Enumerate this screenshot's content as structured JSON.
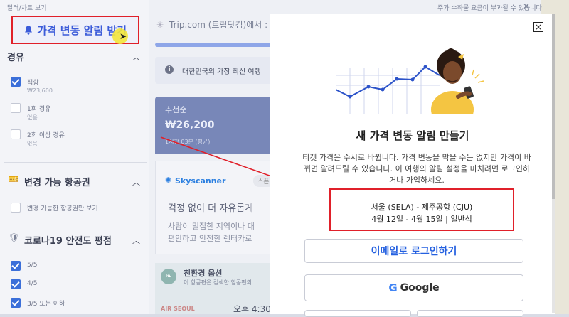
{
  "top": {
    "left_link": "달러/차트 보기",
    "right_text": "주가 수하물 요금이 부과될 수 있습니다",
    "close": "✕"
  },
  "sidebar": {
    "alert_button": "가격 변동 알림 받기",
    "sections": {
      "stops": {
        "title": "경유",
        "items": [
          {
            "label": "직항",
            "sub": "₩23,600",
            "checked": true
          },
          {
            "label": "1회 경유",
            "sub": "없음",
            "checked": false
          },
          {
            "label": "2회 이상 경유",
            "sub": "없음",
            "checked": false
          }
        ]
      },
      "airports": {
        "title": "변경 가능 항공권",
        "items": [
          {
            "label": "변경 가능한 항공권만 보기",
            "checked": false
          }
        ]
      },
      "covid": {
        "title": "코로나19 안전도 평점",
        "items": [
          {
            "label": "5/5",
            "checked": true
          },
          {
            "label": "4/5",
            "checked": true
          },
          {
            "label": "3/5 또는 이하",
            "checked": true
          }
        ]
      }
    }
  },
  "main": {
    "trip_line": "Trip.com (트립닷컴)에서 :",
    "info_text": "대한민국의 가장 최신 여행",
    "price_card": {
      "title": "추천순",
      "price": "₩26,200",
      "duration": "1시간 03분 (평균)"
    },
    "promo": {
      "brand": "Skyscanner",
      "tab": "스폰",
      "heading": "걱정 없이 더 자유롭게",
      "text1": "사람이 밀집한 지역이나 대",
      "text2": "편안하고 안전한 렌터카로"
    },
    "eco": {
      "title": "친환경 옵션",
      "sub": "이 항공편은 검색한 항공편의"
    },
    "airline": "AIR SEOUL",
    "flight_time": "오후 4:30"
  },
  "modal": {
    "close_icon": "close-icon",
    "title": "새 가격 변동 알림 만들기",
    "desc_line1": "티켓 가격은 수시로 바뀝니다. 가격 변동을 막을 수는 없지만 가격이 바",
    "desc_line2": "뀌면 알려드릴 수 있습니다. 이 여행의 알림 설정을 마치려면 로그인하",
    "desc_line3": "거나 가입하세요.",
    "route": "서울 (SELA) - 제주공항 (CJU)",
    "dates": "4월 12일 - 4월 15일 | 일반석",
    "email_button": "이메일로 로그인하기",
    "google_button": "Google",
    "google_g": "G"
  },
  "colors": {
    "accent": "#2460e0",
    "highlight": "#e0202a"
  }
}
